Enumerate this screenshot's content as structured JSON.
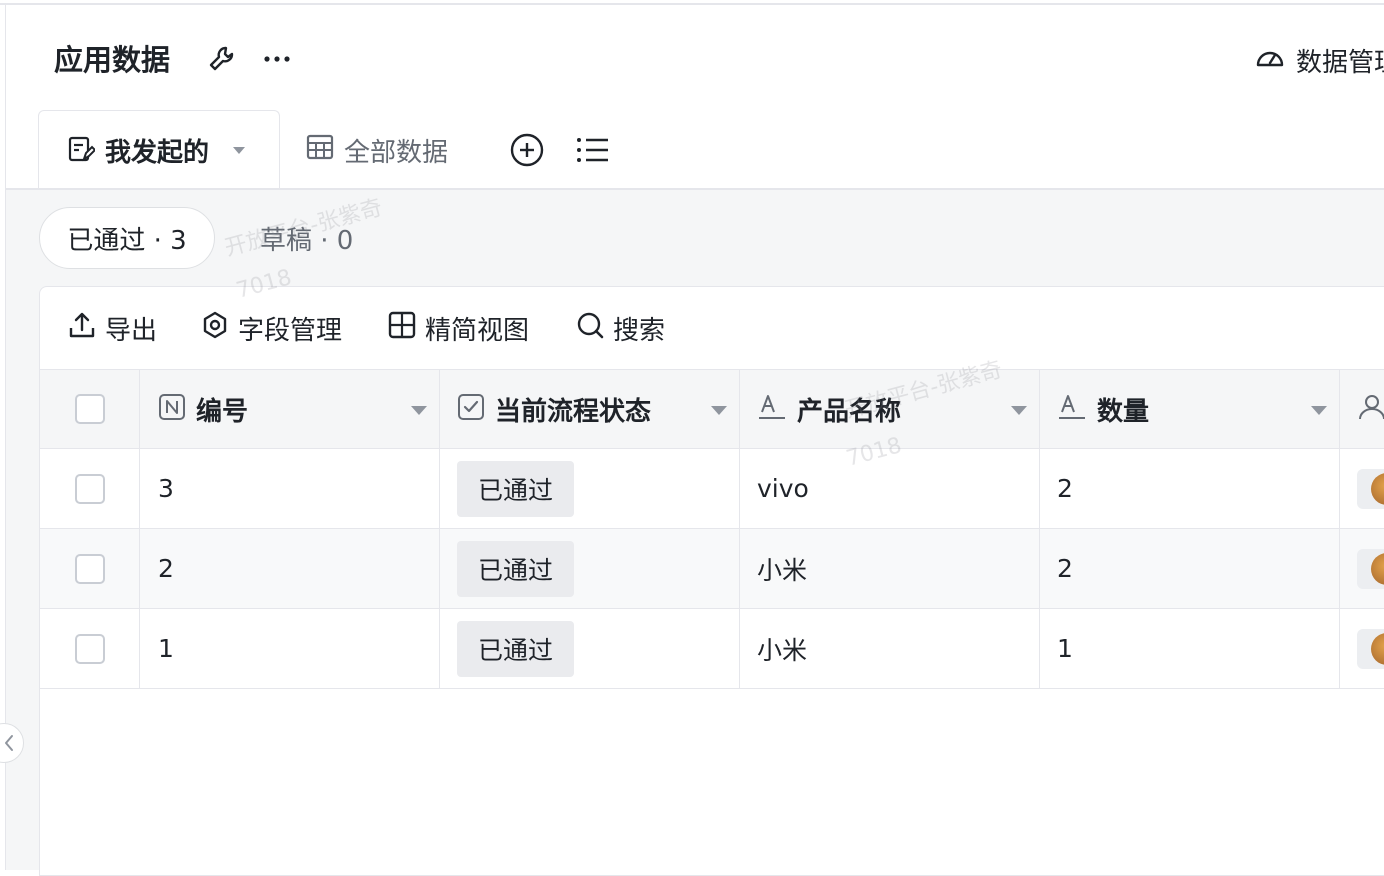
{
  "header": {
    "title": "应用数据",
    "data_manage_label": "数据管理"
  },
  "tabs": [
    {
      "label": "我发起的",
      "active": true
    },
    {
      "label": "全部数据",
      "active": false
    }
  ],
  "filters": {
    "approved_label": "已通过 · 3",
    "draft_label": "草稿 · 0"
  },
  "toolbar": {
    "export_label": "导出",
    "fields_label": "字段管理",
    "view_label": "精简视图",
    "search_label": "搜索"
  },
  "table": {
    "columns": [
      "编号",
      "当前流程状态",
      "产品名称",
      "数量"
    ],
    "rows": [
      {
        "id": "3",
        "status": "已通过",
        "product": "vivo",
        "qty": "2"
      },
      {
        "id": "2",
        "status": "已通过",
        "product": "小米",
        "qty": "2"
      },
      {
        "id": "1",
        "status": "已通过",
        "product": "小米",
        "qty": "1"
      }
    ]
  },
  "watermark": {
    "name": "开放平台-张紫奇",
    "code": "7018"
  },
  "colors": {
    "border": "#e5e6eb",
    "surface": "#f5f6f7",
    "text": "#1f2329",
    "muted": "#646a73",
    "status_bg": "#eaebee"
  }
}
